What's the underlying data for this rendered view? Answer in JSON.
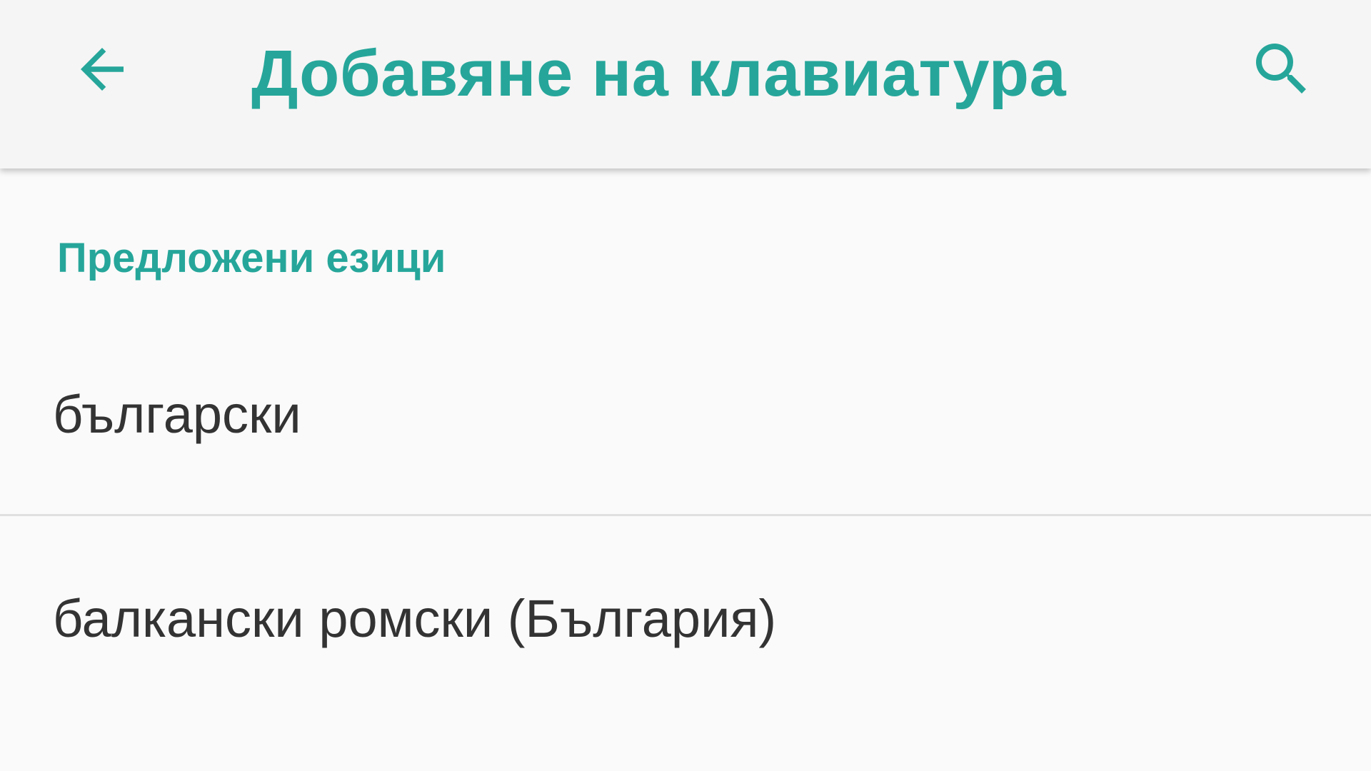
{
  "app_bar": {
    "back_icon": "arrow-back-icon",
    "title": "Добавяне на клавиатура",
    "search_icon": "search-icon",
    "accent_color": "#26a69a"
  },
  "section": {
    "header": "Предложени езици"
  },
  "languages": [
    {
      "label": "български"
    },
    {
      "label": "балкански ромски (България)"
    }
  ]
}
